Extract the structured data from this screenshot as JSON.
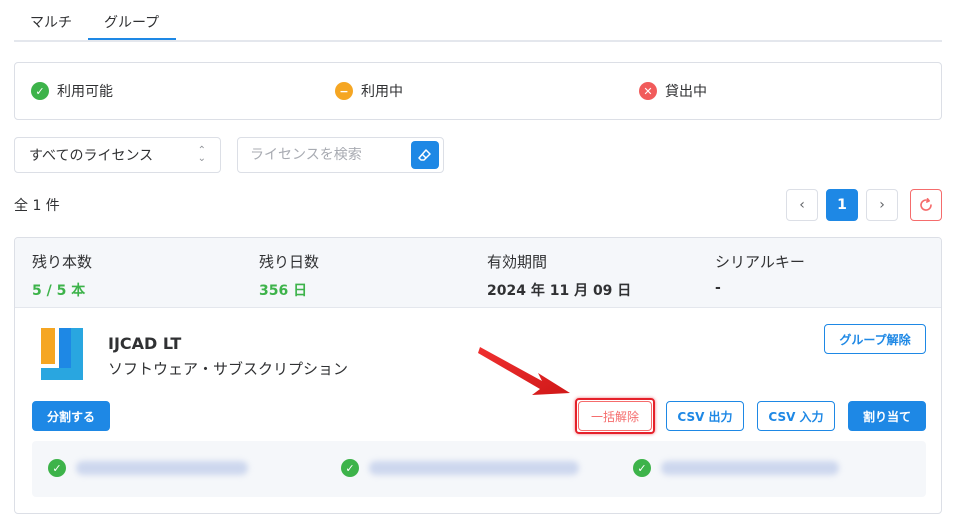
{
  "tabs": [
    {
      "label": "マルチ"
    },
    {
      "label": "グループ"
    }
  ],
  "legend": {
    "available": "利用可能",
    "in_use": "利用中",
    "lent": "貸出中"
  },
  "filter": {
    "select_value": "すべてのライセンス",
    "search_placeholder": "ライセンスを検索"
  },
  "count_text": "全 1 件",
  "pagination": {
    "current_page": "1",
    "prev": "‹",
    "next": "›"
  },
  "card": {
    "stats": [
      {
        "label": "残り本数",
        "value": "5 / 5 本"
      },
      {
        "label": "残り日数",
        "value": "356 日"
      },
      {
        "label": "有効期間",
        "value": "2024 年 11 月 09 日"
      },
      {
        "label": "シリアルキー",
        "value": "-"
      }
    ],
    "product_name": "IJCAD LT",
    "product_type": "ソフトウェア・サブスクリプション",
    "buttons": {
      "ungroup": "グループ解除",
      "split": "分割する",
      "bulk_release": "一括解除",
      "csv_out": "CSV 出力",
      "csv_in": "CSV 入力",
      "assign": "割り当て"
    }
  },
  "colors": {
    "primary": "#1e88e5",
    "available": "#3db34a",
    "in_use": "#f5a623",
    "lent": "#f15b5b",
    "highlight": "#e5202a"
  }
}
